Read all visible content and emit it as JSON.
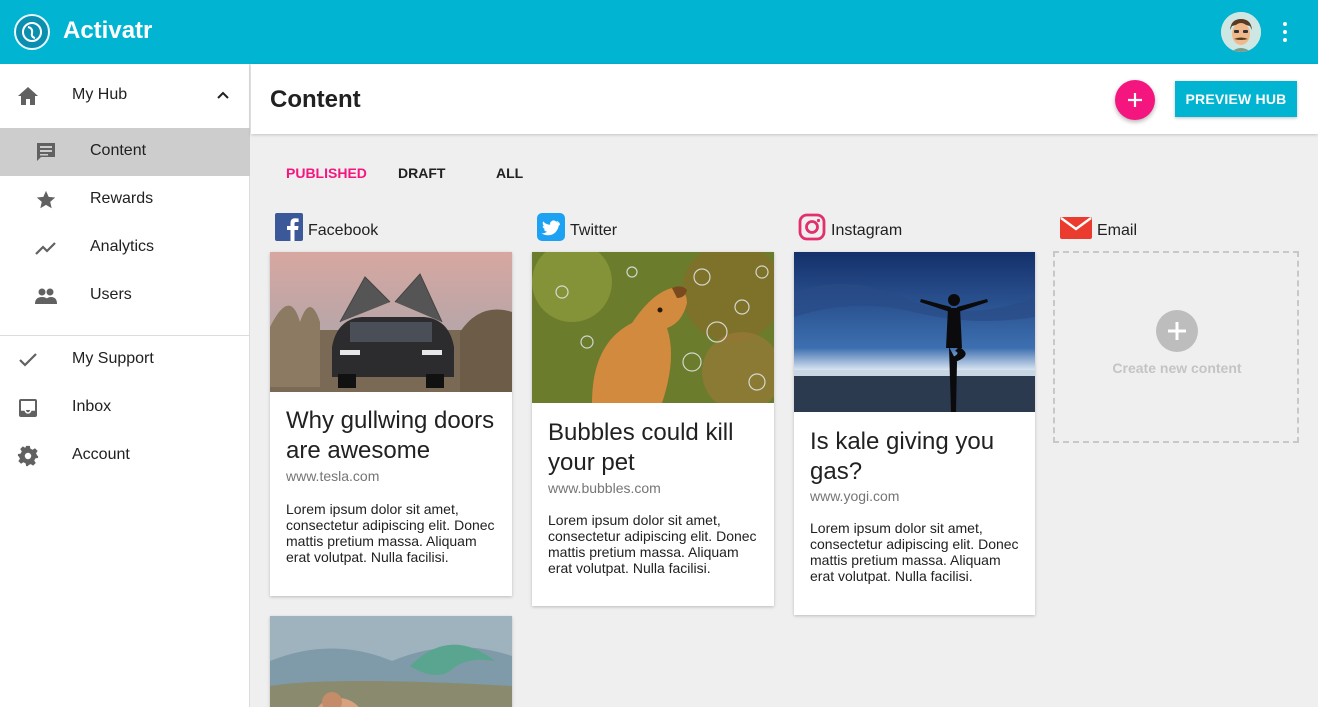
{
  "app": {
    "title": "Activatr",
    "logo_icon": "activatr-logo",
    "accent": "#00b4d2",
    "pink": "#f5157f"
  },
  "sidebar": {
    "hub": {
      "label": "My Hub",
      "icon": "home-icon"
    },
    "items": [
      {
        "label": "Content",
        "icon": "message-icon",
        "active": true
      },
      {
        "label": "Rewards",
        "icon": "star-icon"
      },
      {
        "label": "Analytics",
        "icon": "trending-icon"
      },
      {
        "label": "Users",
        "icon": "people-icon"
      }
    ],
    "bottom": [
      {
        "label": "My Support",
        "icon": "check-icon"
      },
      {
        "label": "Inbox",
        "icon": "inbox-icon"
      },
      {
        "label": "Account",
        "icon": "gear-icon"
      }
    ]
  },
  "header": {
    "title": "Content",
    "preview_label": "PREVIEW HUB"
  },
  "tabs": [
    "PUBLISHED",
    "DRAFT",
    "ALL"
  ],
  "channels": [
    "Facebook",
    "Twitter",
    "Instagram",
    "Email"
  ],
  "cards": [
    {
      "title": "Why gullwing doors are awesome",
      "url": "www.tesla.com",
      "body": "Lorem ipsum dolor sit amet, consectetur adipiscing elit. Donec mattis pretium massa. Aliquam erat volutpat. Nulla facilisi."
    },
    {
      "title": "Bubbles could kill your pet",
      "url": "www.bubbles.com",
      "body": "Lorem ipsum dolor sit amet, consectetur adipiscing elit. Donec mattis pretium massa. Aliquam erat volutpat. Nulla facilisi."
    },
    {
      "title": "Is kale giving you gas?",
      "url": "www.yogi.com",
      "body": "Lorem ipsum dolor sit amet, consectetur adipiscing elit. Donec mattis pretium massa. Aliquam erat volutpat. Nulla facilisi."
    }
  ],
  "create": {
    "label": "Create new content"
  }
}
